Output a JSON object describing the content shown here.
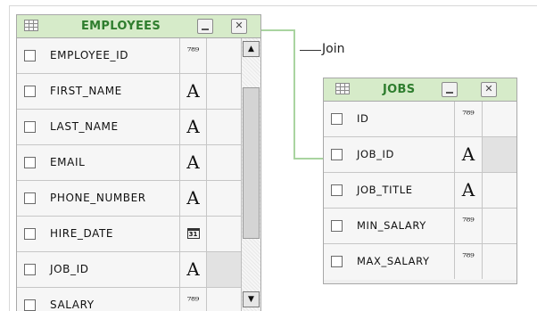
{
  "employees": {
    "title": "EMPLOYEES",
    "minimize_glyph": "",
    "close_glyph": "✕",
    "columns": [
      {
        "name": "EMPLOYEE_ID",
        "type": "⁷⁸⁹"
      },
      {
        "name": "FIRST_NAME",
        "type": "A"
      },
      {
        "name": "LAST_NAME",
        "type": "A"
      },
      {
        "name": "EMAIL",
        "type": "A"
      },
      {
        "name": "PHONE_NUMBER",
        "type": "A"
      },
      {
        "name": "HIRE_DATE",
        "type": "31"
      },
      {
        "name": "JOB_ID",
        "type": "A"
      },
      {
        "name": "SALARY",
        "type": "⁷⁸⁹"
      }
    ],
    "scroll_up": "▲",
    "scroll_down": "▼"
  },
  "jobs": {
    "title": "JOBS",
    "close_glyph": "✕",
    "columns": [
      {
        "name": "ID",
        "type": "⁷⁸⁹"
      },
      {
        "name": "JOB_ID",
        "type": "A"
      },
      {
        "name": "JOB_TITLE",
        "type": "A"
      },
      {
        "name": "MIN_SALARY",
        "type": "⁷⁸⁹"
      },
      {
        "name": "MAX_SALARY",
        "type": "⁷⁸⁹"
      }
    ]
  },
  "join_label": "Join",
  "colors": {
    "header_bg": "#d6ebc9",
    "title_text": "#2e7d2e",
    "join_line": "#a9d4a0"
  }
}
